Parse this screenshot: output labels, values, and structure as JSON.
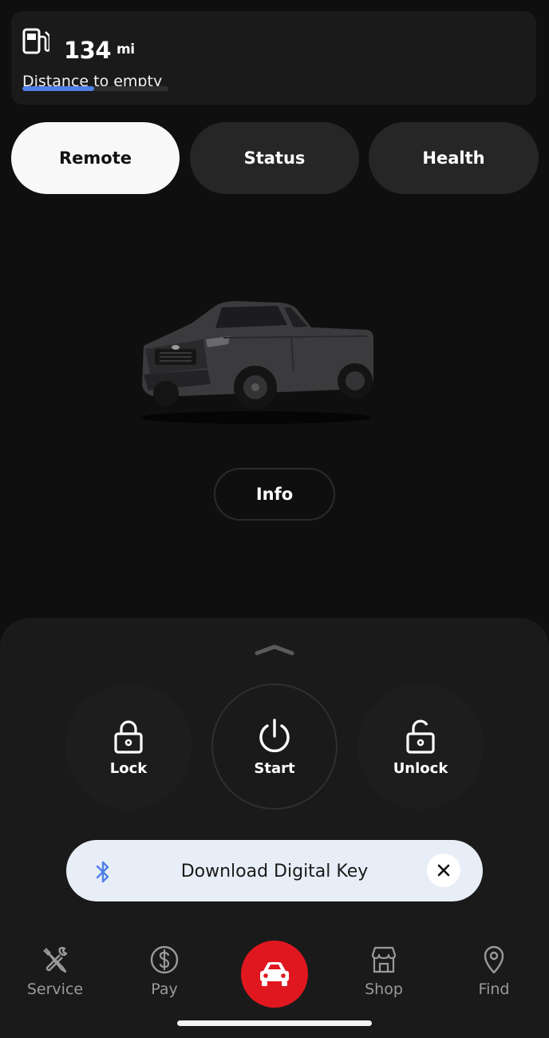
{
  "range": {
    "value": "134",
    "unit": "mi",
    "label": "Distance to empty",
    "fill_percent": 49,
    "icon": "fuel-pump-icon",
    "bar_color": "#4f7ee6"
  },
  "tabs": [
    {
      "label": "Remote",
      "active": true
    },
    {
      "label": "Status",
      "active": false
    },
    {
      "label": "Health",
      "active": false
    }
  ],
  "info_button": {
    "label": "Info"
  },
  "remote_actions": [
    {
      "label": "Lock",
      "icon": "lock-icon"
    },
    {
      "label": "Start",
      "icon": "power-icon"
    },
    {
      "label": "Unlock",
      "icon": "unlock-icon"
    }
  ],
  "digital_key": {
    "label": "Download Digital Key",
    "icon": "bluetooth-icon",
    "close_icon": "close-icon"
  },
  "nav": {
    "items": [
      {
        "label": "Service",
        "icon": "wrench-screwdriver-icon"
      },
      {
        "label": "Pay",
        "icon": "dollar-icon"
      },
      {
        "label": "Shop",
        "icon": "store-icon"
      },
      {
        "label": "Find",
        "icon": "map-pin-icon"
      }
    ],
    "center_icon": "car-icon",
    "accent_color": "#e0171f"
  }
}
